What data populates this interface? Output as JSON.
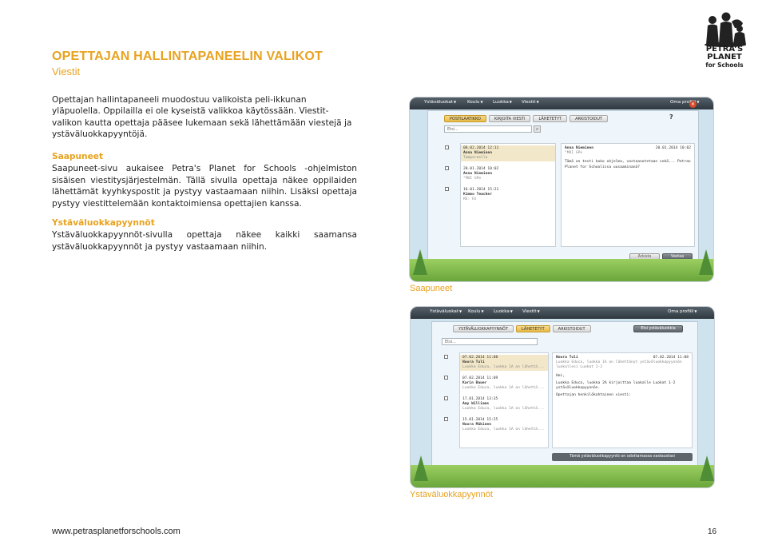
{
  "header": {
    "title": "OPETTAJAN HALLINTAPANEELIN VALIKOT",
    "subtitle": "Viestit"
  },
  "logo": {
    "line1": "PETRA'S",
    "line2": "PLANET",
    "line3": "for Schools"
  },
  "intro": "Opettajan hallintapaneeli muodostuu valikoista peli-ikkunan yläpuolella. Oppilailla ei ole kyseistä valikkoa käytössään. Viestit-valikon kautta opettaja pääsee lukemaan sekä lähettämään viestejä ja ystäväluokkapyyntöjä.",
  "sections": [
    {
      "heading": "Saapuneet",
      "body": "Saapuneet-sivu aukaisee Petra's Planet for Schools -ohjelmiston sisäisen viestitysjärjestelmän. Tällä sivulla opettaja näkee oppilaiden lähettämät kyyhkyspostit ja pystyy vastaamaan niihin. Lisäksi opettaja pystyy viestittelemään kontaktoimiensa opettajien kanssa."
    },
    {
      "heading": "Ystäväluokkapyynnöt",
      "body": "Ystäväluokkapyynnöt-sivulla opettaja näkee kaikki saamansa ystäväluokkapyynnöt ja pystyy vastaamaan niihin."
    }
  ],
  "screenshot1": {
    "caption": "Saapuneet",
    "menu": [
      "Ystäväluokat",
      "Koulu",
      "Luokka",
      "Viestit"
    ],
    "profile": "Oma profiili",
    "tabs": [
      "POSTILAATIKKO",
      "KIRJOITA VIESTI",
      "LÄHETETYT",
      "ARKISTOIDUT"
    ],
    "search_placeholder": "Etsi...",
    "help": "?",
    "messages": [
      {
        "date": "08.02.2014 12:11",
        "name": "Anna Nieminen",
        "line": "Tampereella"
      },
      {
        "date": "20.01.2014 10:02",
        "name": "Anna Nieminen",
        "line": "\"MOI GPe"
      },
      {
        "date": "16.01.2014 15:21",
        "name": "Kimmo Teacher",
        "line": "RE: Hi"
      }
    ],
    "reading": {
      "from": "Anna Nieminen",
      "date": "20.01.2014 10:02",
      "subject": "\"MOI GPe",
      "body": "Tämä on testi koko ohjelma, vastaanotetaan sekä... Petran Planet for Schoolissa uusaaminanä?"
    },
    "archive_button": "Arkisto",
    "reply_button": "Vastaa"
  },
  "screenshot2": {
    "caption": "Ystäväluokkapyynnöt",
    "menu": [
      "Ystäväluokat",
      "Koulu",
      "Luokka",
      "Viestit"
    ],
    "profile": "Oma profiili",
    "tabs": [
      "YSTÄVÄLUOKKAPYYNNÖT",
      "LÄHETETYT",
      "ARKISTOIDUT"
    ],
    "send_button": "Etsi ystäväluokkia",
    "search_placeholder": "Etsi...",
    "messages": [
      {
        "date": "07.02.2014 11:08",
        "name": "Noora Tuli",
        "line": "Luokka Educa, luokka 1A on lähettä..."
      },
      {
        "date": "07.02.2014 11:09",
        "name": "Karin Bauer",
        "line": "Luokka Educa, luokka 1A on lähettä..."
      },
      {
        "date": "17.01.2014 13:35",
        "name": "Amy Williams",
        "line": "Luokka Educa, luokka 1A on lähettä..."
      },
      {
        "date": "15.01.2014 15:25",
        "name": "Noora Mäkinen",
        "line": "Luokka Educa, luokka 1A on lähettä..."
      }
    ],
    "reading": {
      "from": "Noora Tuli",
      "date": "07.02.2014 11:08",
      "subject": "Luokka Educa, luokka 1A on lähettänyt ystäväluokkapyynnön luokallesi Luokat 1-2",
      "greeting": "Hei,",
      "body": "Luokka Educa, luokka 2A kirjoittaa luokalle Luokat 1-2 ystäväluokkapyynnön.",
      "sign": "Opettajan henkilökohtainen viesti:"
    },
    "footer_note": "Tämä ystäväluokkapyyntö on odottamassa vastaustasi"
  },
  "footer": {
    "url": "www.petrasplanetforschools.com",
    "page": "16"
  },
  "colors": {
    "accent": "#e8a21e",
    "ui_bar": "#3a444c",
    "ui_bg": "#cfe3ef"
  }
}
